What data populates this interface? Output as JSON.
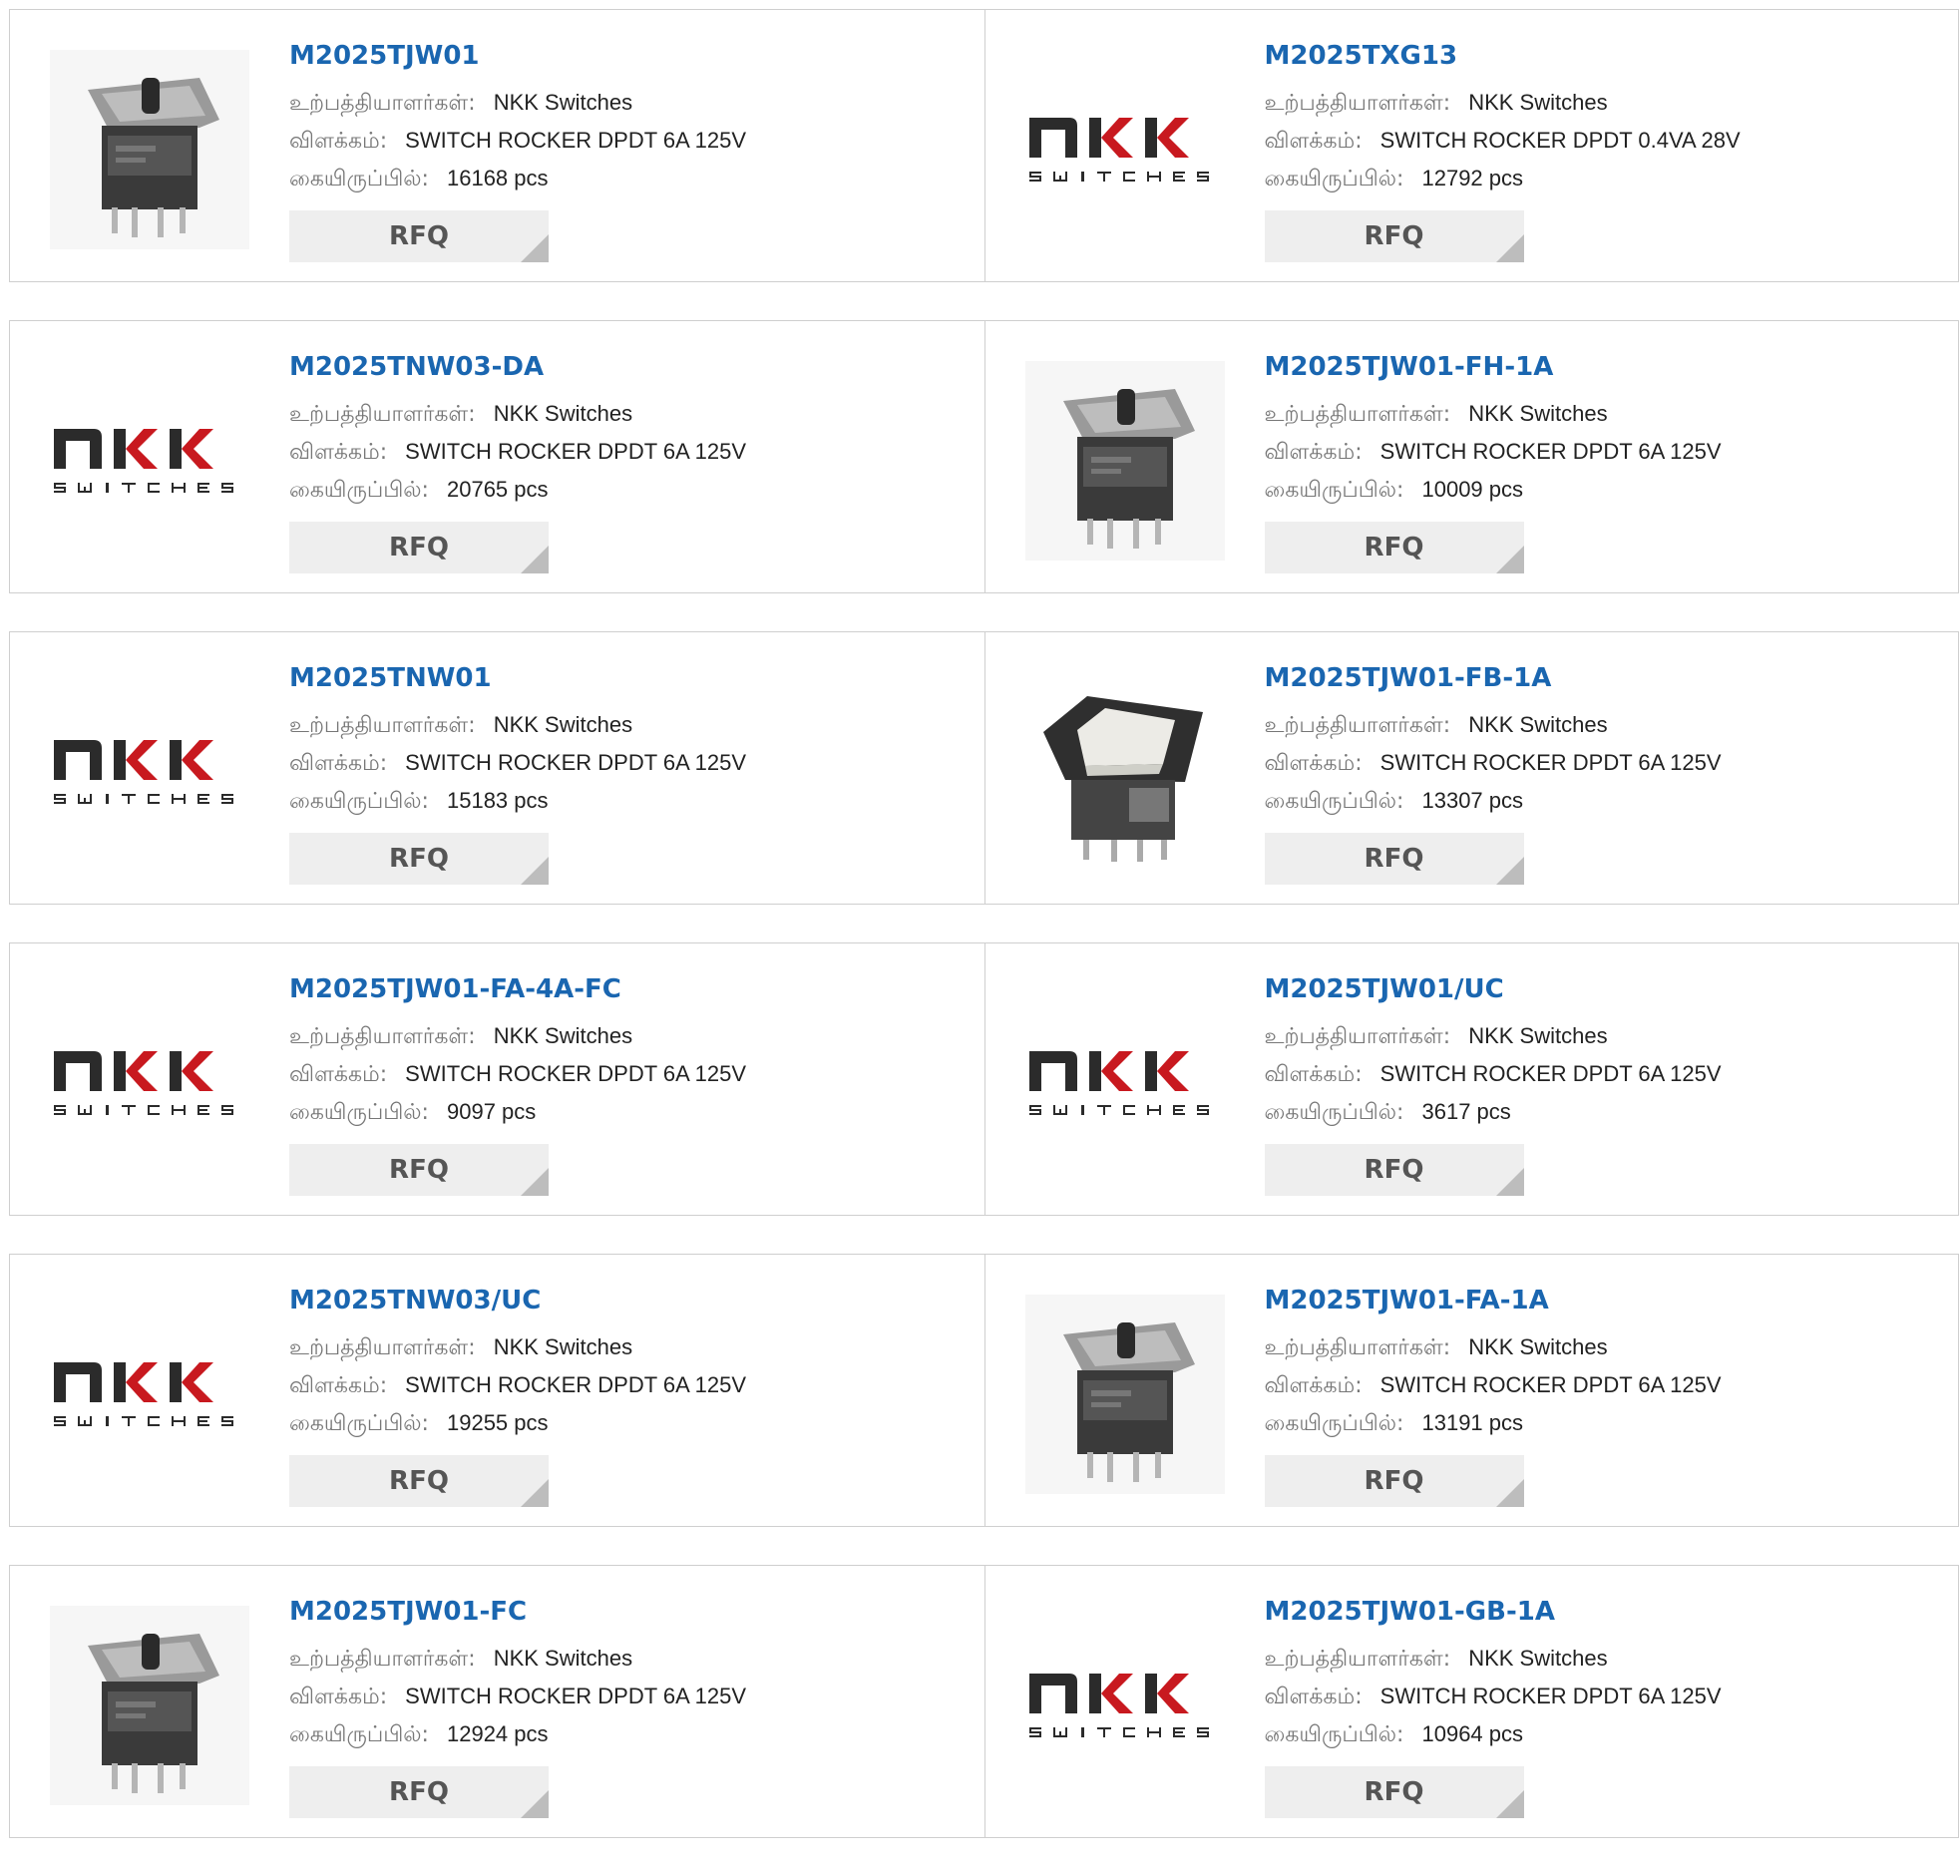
{
  "labels": {
    "manufacturer": "உற்பத்தியாளர்கள்:",
    "description": "விளக்கம்:",
    "stock": "கையிருப்பில்:"
  },
  "colors": {
    "part_link": "#1a66b0",
    "rfq_bg": "#eeeeee",
    "nkk_red": "#c8191f"
  },
  "rows": [
    [
      {
        "part": "M2025TJW01",
        "manufacturer": "NKK Switches",
        "description": "SWITCH ROCKER DPDT 6A 125V",
        "stock": "16168 pcs",
        "image": "toggle-switch-photo",
        "rfq": "RFQ"
      },
      {
        "part": "M2025TXG13",
        "manufacturer": "NKK Switches",
        "description": "SWITCH ROCKER DPDT 0.4VA 28V",
        "stock": "12792 pcs",
        "image": "nkk-logo",
        "rfq": "RFQ"
      }
    ],
    [
      {
        "part": "M2025TNW03-DA",
        "manufacturer": "NKK Switches",
        "description": "SWITCH ROCKER DPDT 6A 125V",
        "stock": "20765 pcs",
        "image": "nkk-logo",
        "rfq": "RFQ"
      },
      {
        "part": "M2025TJW01-FH-1A",
        "manufacturer": "NKK Switches",
        "description": "SWITCH ROCKER DPDT 6A 125V",
        "stock": "10009 pcs",
        "image": "toggle-switch-photo",
        "rfq": "RFQ"
      }
    ],
    [
      {
        "part": "M2025TNW01",
        "manufacturer": "NKK Switches",
        "description": "SWITCH ROCKER DPDT 6A 125V",
        "stock": "15183 pcs",
        "image": "nkk-logo",
        "rfq": "RFQ"
      },
      {
        "part": "M2025TJW01-FB-1A",
        "manufacturer": "NKK Switches",
        "description": "SWITCH ROCKER DPDT 6A 125V",
        "stock": "13307 pcs",
        "image": "rocker-switch-photo",
        "rfq": "RFQ"
      }
    ],
    [
      {
        "part": "M2025TJW01-FA-4A-FC",
        "manufacturer": "NKK Switches",
        "description": "SWITCH ROCKER DPDT 6A 125V",
        "stock": "9097 pcs",
        "image": "nkk-logo",
        "rfq": "RFQ"
      },
      {
        "part": "M2025TJW01/UC",
        "manufacturer": "NKK Switches",
        "description": "SWITCH ROCKER DPDT 6A 125V",
        "stock": "3617 pcs",
        "image": "nkk-logo",
        "rfq": "RFQ"
      }
    ],
    [
      {
        "part": "M2025TNW03/UC",
        "manufacturer": "NKK Switches",
        "description": "SWITCH ROCKER DPDT 6A 125V",
        "stock": "19255 pcs",
        "image": "nkk-logo",
        "rfq": "RFQ"
      },
      {
        "part": "M2025TJW01-FA-1A",
        "manufacturer": "NKK Switches",
        "description": "SWITCH ROCKER DPDT 6A 125V",
        "stock": "13191 pcs",
        "image": "toggle-switch-photo",
        "rfq": "RFQ"
      }
    ],
    [
      {
        "part": "M2025TJW01-FC",
        "manufacturer": "NKK Switches",
        "description": "SWITCH ROCKER DPDT 6A 125V",
        "stock": "12924 pcs",
        "image": "toggle-switch-photo",
        "rfq": "RFQ"
      },
      {
        "part": "M2025TJW01-GB-1A",
        "manufacturer": "NKK Switches",
        "description": "SWITCH ROCKER DPDT 6A 125V",
        "stock": "10964 pcs",
        "image": "nkk-logo",
        "rfq": "RFQ"
      }
    ]
  ]
}
